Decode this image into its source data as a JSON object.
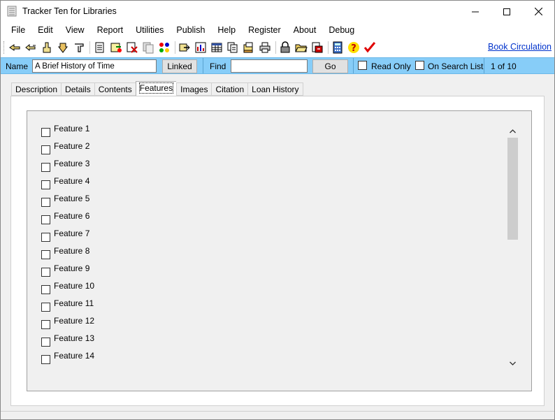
{
  "window": {
    "title": "Tracker Ten for Libraries",
    "minimize_icon": "minimize-icon",
    "maximize_icon": "maximize-icon",
    "close_icon": "close-icon"
  },
  "menu": [
    "File",
    "Edit",
    "View",
    "Report",
    "Utilities",
    "Publish",
    "Help",
    "Register",
    "About",
    "Debug"
  ],
  "toolbar": {
    "icons": [
      "first-record-icon",
      "previous-record-icon",
      "add-record-icon",
      "next-record-icon",
      "last-record-icon",
      "edit-icon",
      "save-icon",
      "delete-icon",
      "copy-icon",
      "color-icon",
      "search-icon",
      "chart-icon",
      "grid-icon",
      "pages-icon",
      "print-icon",
      "lock-icon",
      "folder-icon",
      "export-icon",
      "calculator-icon",
      "help-icon",
      "checkmark-icon"
    ],
    "book_circulation": "Book Circulation"
  },
  "infobar": {
    "name_label": "Name",
    "name_value": "A Brief History of Time",
    "linked_button": "Linked",
    "find_label": "Find",
    "find_value": "",
    "go_button": "Go",
    "read_only_label": "Read Only",
    "on_search_list_label": "On Search List",
    "record_position": "1 of 10"
  },
  "tabs": [
    "Description",
    "Details",
    "Contents",
    "Features",
    "Images",
    "Citation",
    "Loan History"
  ],
  "active_tab": "Features",
  "features": [
    "Feature 1",
    "Feature 2",
    "Feature 3",
    "Feature 4",
    "Feature 5",
    "Feature 6",
    "Feature 7",
    "Feature 8",
    "Feature  9",
    "Feature 10",
    "Feature 11",
    "Feature 12",
    "Feature 13",
    "Feature 14"
  ],
  "scrollbar": {
    "up_icon": "chevron-up-icon",
    "down_icon": "chevron-down-icon"
  }
}
